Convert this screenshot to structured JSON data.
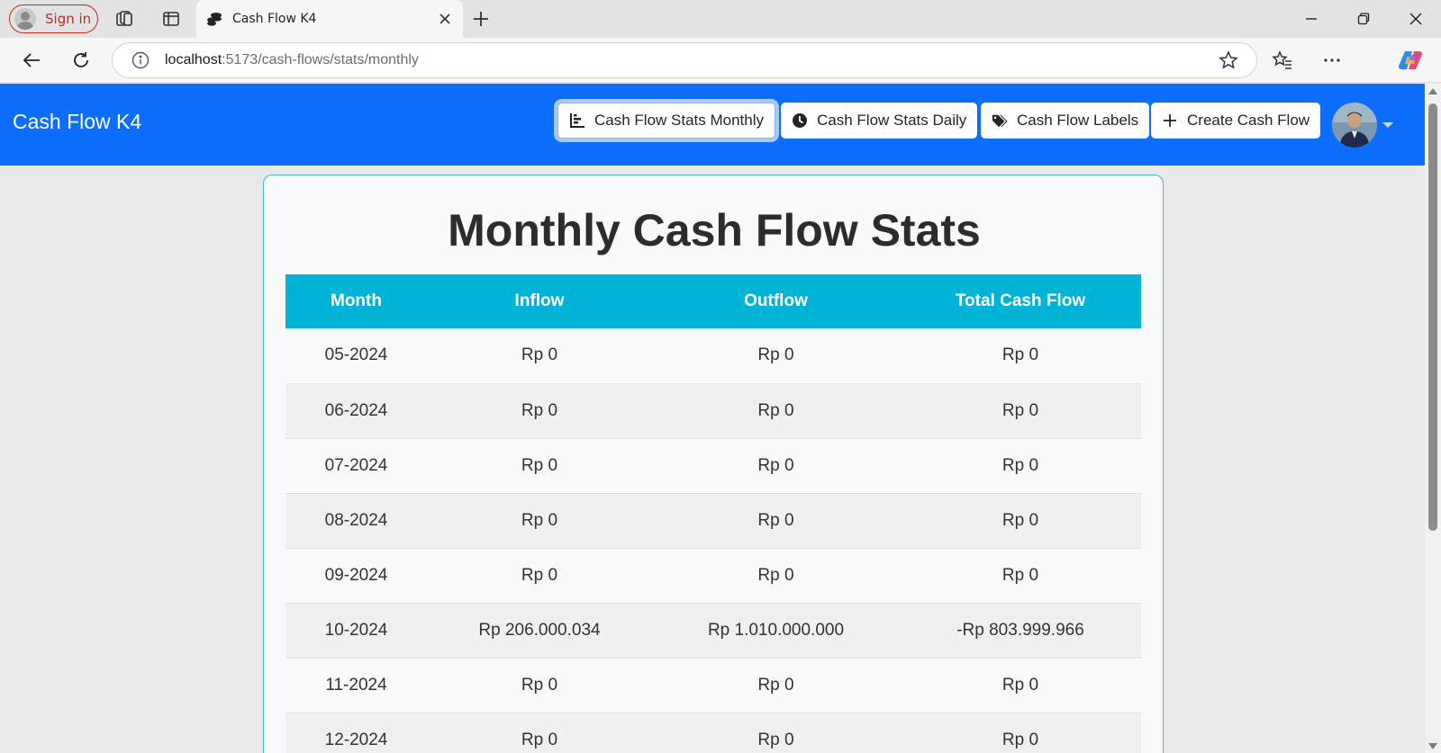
{
  "browser": {
    "signin_label": "Sign in",
    "tab_title": "Cash Flow K4",
    "url_host": "localhost",
    "url_rest": ":5173/cash-flows/stats/monthly"
  },
  "navbar": {
    "brand": "Cash Flow K4",
    "buttons": [
      {
        "label": "Cash Flow Stats Monthly",
        "icon": "bar-chart-icon",
        "active": true
      },
      {
        "label": "Cash Flow Stats Daily",
        "icon": "clock-icon",
        "active": false
      },
      {
        "label": "Cash Flow Labels",
        "icon": "tags-icon",
        "active": false
      },
      {
        "label": "Create Cash Flow",
        "icon": "plus-icon",
        "active": false
      }
    ],
    "accent_color": "#0d6efd"
  },
  "page": {
    "title": "Monthly Cash Flow Stats",
    "header_color": "#00b4d8",
    "columns": [
      "Month",
      "Inflow",
      "Outflow",
      "Total Cash Flow"
    ],
    "rows": [
      [
        "05-2024",
        "Rp 0",
        "Rp 0",
        "Rp 0"
      ],
      [
        "06-2024",
        "Rp 0",
        "Rp 0",
        "Rp 0"
      ],
      [
        "07-2024",
        "Rp 0",
        "Rp 0",
        "Rp 0"
      ],
      [
        "08-2024",
        "Rp 0",
        "Rp 0",
        "Rp 0"
      ],
      [
        "09-2024",
        "Rp 0",
        "Rp 0",
        "Rp 0"
      ],
      [
        "10-2024",
        "Rp 206.000.034",
        "Rp 1.010.000.000",
        "-Rp 803.999.966"
      ],
      [
        "11-2024",
        "Rp 0",
        "Rp 0",
        "Rp 0"
      ],
      [
        "12-2024",
        "Rp 0",
        "Rp 0",
        "Rp 0"
      ]
    ]
  }
}
